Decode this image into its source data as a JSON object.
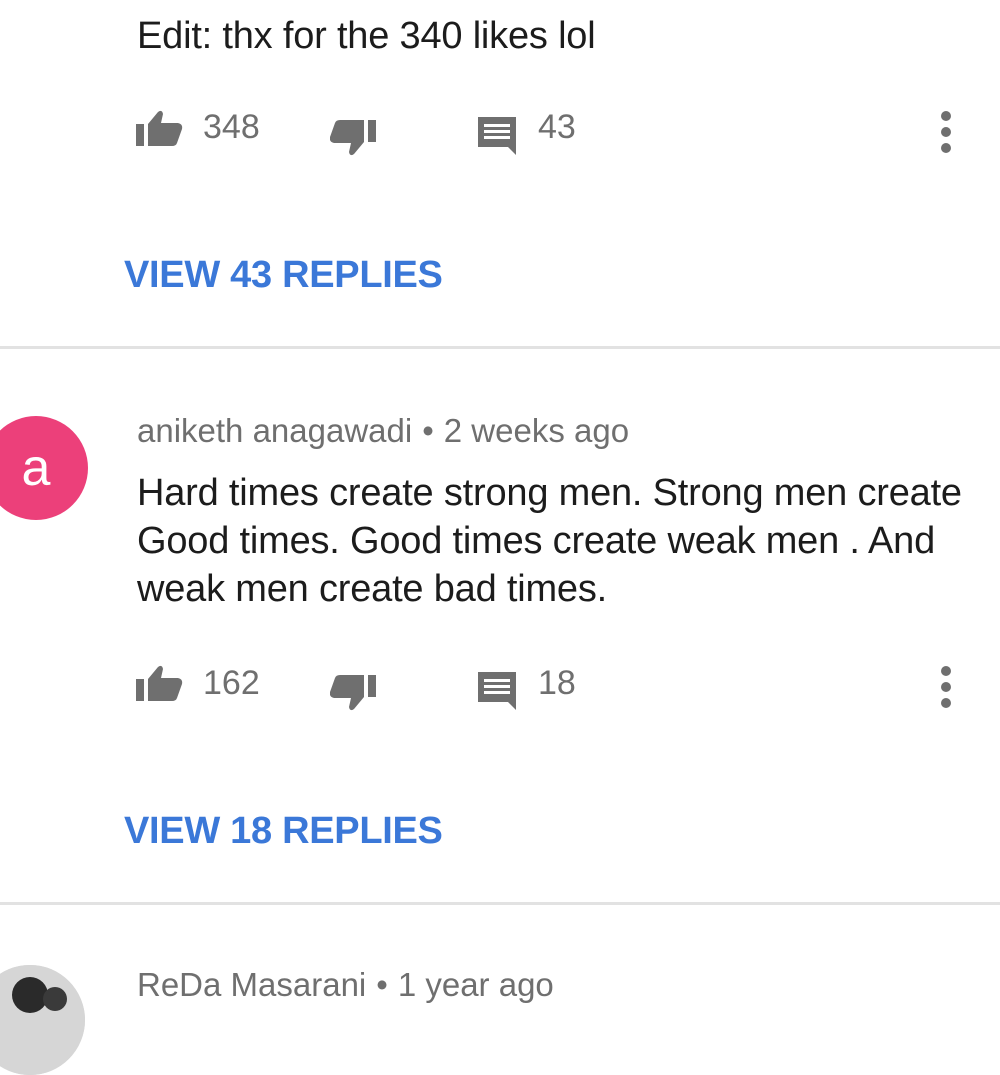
{
  "comments": [
    {
      "text_tail": "Edit: thx for the 340 likes lol",
      "likes": "348",
      "replies_count": "43",
      "view_replies": "VIEW 43 REPLIES"
    },
    {
      "avatar_letter": "a",
      "author": "aniketh anagawadi",
      "separator": "•",
      "time": "2 weeks ago",
      "text": "Hard times create strong men. Strong men create Good times. Good times create weak men . And weak men create bad times.",
      "likes": "162",
      "replies_count": "18",
      "view_replies": "VIEW 18 REPLIES"
    },
    {
      "author": "ReDa Masarani",
      "separator": "•",
      "time": "1 year ago"
    }
  ],
  "colors": {
    "link": "#3b78d8",
    "avatar_bg": "#ec407a",
    "icon": "#6f6f6f"
  },
  "icons": {
    "like": "thumbs-up-icon",
    "dislike": "thumbs-down-icon",
    "reply": "comment-icon",
    "more": "more-vert-icon"
  }
}
